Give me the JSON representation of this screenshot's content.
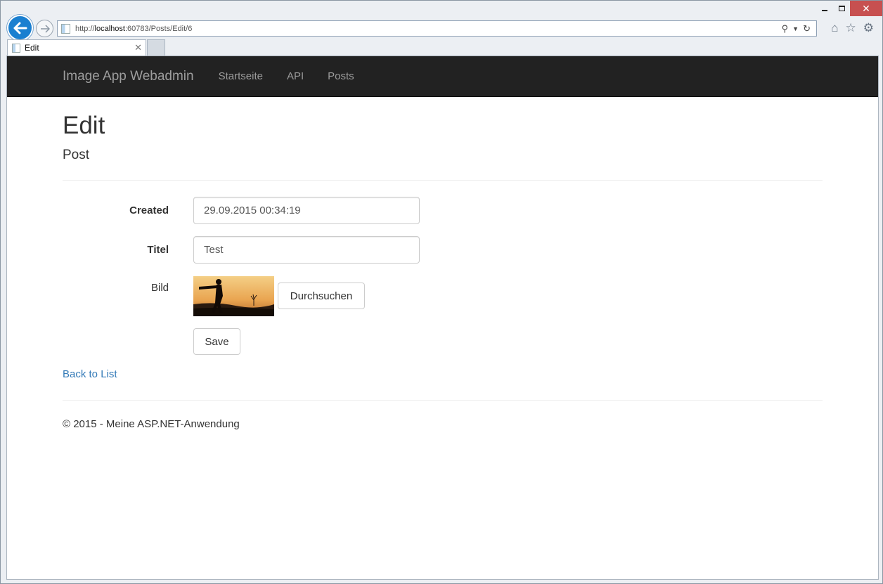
{
  "browser": {
    "url_prefix": "http://",
    "url_host": "localhost",
    "url_rest": ":60783/Posts/Edit/6",
    "tab_title": "Edit"
  },
  "navbar": {
    "brand": "Image App Webadmin",
    "links": [
      "Startseite",
      "API",
      "Posts"
    ]
  },
  "page": {
    "title": "Edit",
    "subtitle": "Post"
  },
  "form": {
    "created_label": "Created",
    "created_value": "29.09.2015 00:34:19",
    "titel_label": "Titel",
    "titel_value": "Test",
    "bild_label": "Bild",
    "browse_button": "Durchsuchen",
    "save_button": "Save"
  },
  "back_link": "Back to List",
  "footer": "© 2015 - Meine ASP.NET-Anwendung",
  "colors": {
    "navbar_bg": "#222222",
    "link": "#337ab7",
    "close_button": "#c75050",
    "back_button": "#1a7fd0"
  }
}
